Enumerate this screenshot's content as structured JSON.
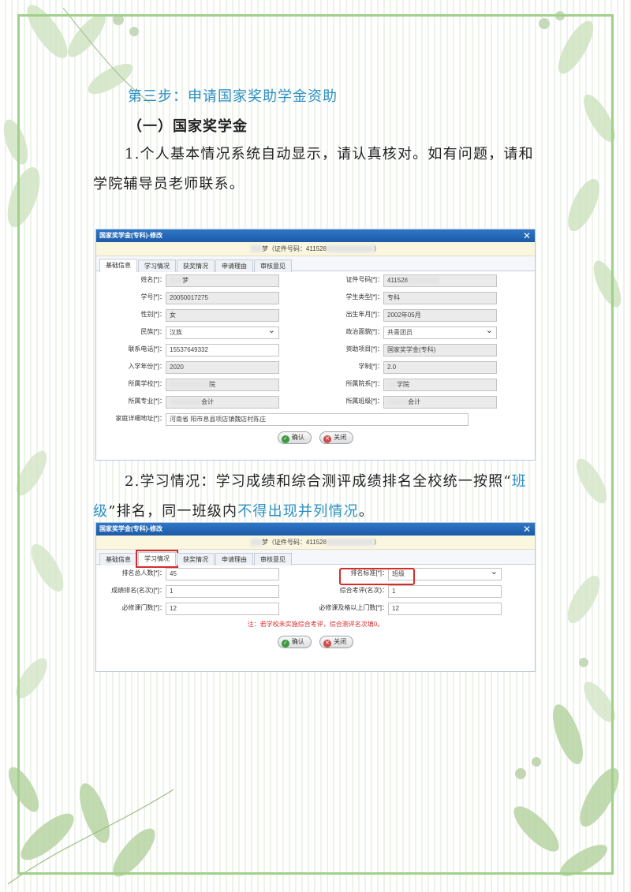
{
  "heading_step": "第三步：申请国家奖助学金资助",
  "heading_section": "（一）国家奖学金",
  "para1": "1.个人基本情况系统自动显示，请认真核对。如有问题，请和学院辅导员老师联系。",
  "para2_prefix": "2.学习情况：学习成绩和综合测评成绩排名全校统一按照“",
  "para2_hl1": "班级",
  "para2_mid": "”排名，同一班级内",
  "para2_hl2": "不得出现并列情况",
  "para2_suffix": "。",
  "dialog_title": "国家奖学金(专科)-修改",
  "close_glyph": "✕",
  "tabs": [
    "基础信息",
    "学习情况",
    "获奖情况",
    "申请理由",
    "审核意见"
  ],
  "dialog1": {
    "subtitle_name": "梦",
    "subtitle_id_label": "（证件号码：411528",
    "subtitle_end": "）",
    "fields": {
      "name_label": "姓名[*]：",
      "name_value": "梦",
      "id_label": "证件号码[*]：",
      "id_value": "411528",
      "student_no_label": "学号[*]：",
      "student_no_value": "20050017275",
      "student_type_label": "学生类型[*]：",
      "student_type_value": "专科",
      "gender_label": "性别[*]：",
      "gender_value": "女",
      "birth_label": "出生年月[*]：",
      "birth_value": "2002年05月",
      "ethnicity_label": "民族[*]：",
      "ethnicity_value": "汉族",
      "politics_label": "政治面貌[*]：",
      "politics_value": "共青团员",
      "phone_label": "联系电话[*]：",
      "phone_value": "15537649332",
      "program_label": "资助项目[*]：",
      "program_value": "国家奖学金(专科)",
      "enroll_label": "入学年份[*]：",
      "enroll_value": "2020",
      "duration_label": "学制[*]：",
      "duration_value": "2.0",
      "school_label": "所属学校[*]：",
      "school_value": "院",
      "college_label": "所属院系[*]：",
      "college_value": "学院",
      "major_label": "所属专业[*]：",
      "major_value": "会计",
      "class_label": "所属班级[*]：",
      "class_value": "会计",
      "address_label": "家庭详细地址[*]：",
      "address_value": "河南省    阳市息县项店镇魏店村陈庄"
    },
    "ok_label": "确认",
    "close_label": "关闭"
  },
  "dialog2": {
    "subtitle_name": "梦",
    "subtitle_id_label": "（证件号码：411528",
    "subtitle_end": "）",
    "fields": {
      "rank_total_label": "排名总人数[*]：",
      "rank_total_value": "45",
      "rank_std_label": "排名标准[*]：",
      "rank_std_value": "班级",
      "grade_rank_label": "成绩排名(名次)[*]：",
      "grade_rank_value": "1",
      "eval_rank_label": "综合考评(名次)：",
      "eval_rank_value": "1",
      "required_label": "必修课门数[*]：",
      "required_value": "12",
      "good_label": "必修课及格以上门数[*]：",
      "good_value": "12"
    },
    "note": "注：若学校未实施综合考评，综合测评名次填0。",
    "ok_label": "确认",
    "close_label": "关闭"
  }
}
